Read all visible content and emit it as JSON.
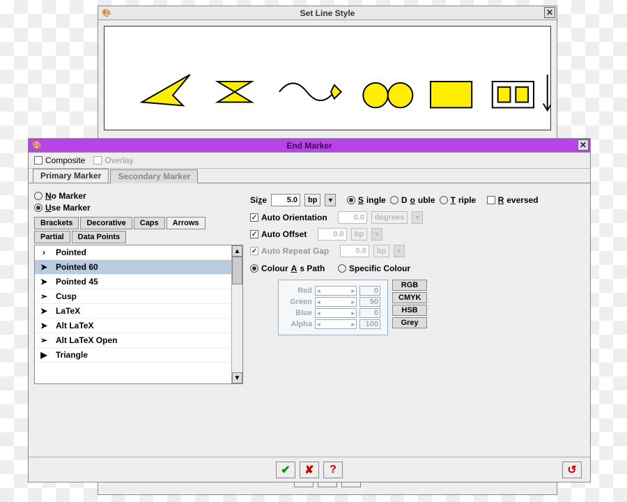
{
  "back_window": {
    "title": "Set Line Style"
  },
  "front_window": {
    "title": "End Marker",
    "composite": "Composite",
    "overlay": "Overlay",
    "tabs": {
      "primary": "Primary Marker",
      "secondary": "Secondary Marker"
    },
    "no_marker": "No Marker",
    "use_marker": "Use Marker",
    "subtabs": {
      "brackets": "Brackets",
      "decorative": "Decorative",
      "caps": "Caps",
      "arrows": "Arrows",
      "partial": "Partial",
      "datapoints": "Data Points"
    },
    "items": [
      "Pointed",
      "Pointed 60",
      "Pointed 45",
      "Cusp",
      "LaTeX",
      "Alt LaTeX",
      "Alt LaTeX Open",
      "Triangle"
    ],
    "size_label": "Size",
    "size_value": "5.0",
    "size_unit": "bp",
    "single": "Single",
    "double": "Double",
    "triple": "Triple",
    "reversed": "Reversed",
    "auto_orient": "Auto Orientation",
    "orient_val": "0.0",
    "orient_unit": "degrees",
    "auto_offset": "Auto Offset",
    "offset_val": "0.0",
    "offset_unit": "bp",
    "auto_repeat": "Auto Repeat Gap",
    "repeat_val": "0.0",
    "repeat_unit": "bp",
    "colour_as_path": "Colour As Path",
    "specific_colour": "Specific Colour",
    "channels": {
      "red": "Red",
      "green": "Green",
      "blue": "Blue",
      "alpha": "Alpha"
    },
    "chan_vals": {
      "red": "0",
      "green": "50",
      "blue": "0",
      "alpha": "100"
    },
    "modes": {
      "rgb": "RGB",
      "cmyk": "CMYK",
      "hsb": "HSB",
      "grey": "Grey"
    }
  },
  "actions": {
    "ok": "✓",
    "cancel": "✗",
    "help": "?",
    "reset": "↻"
  }
}
